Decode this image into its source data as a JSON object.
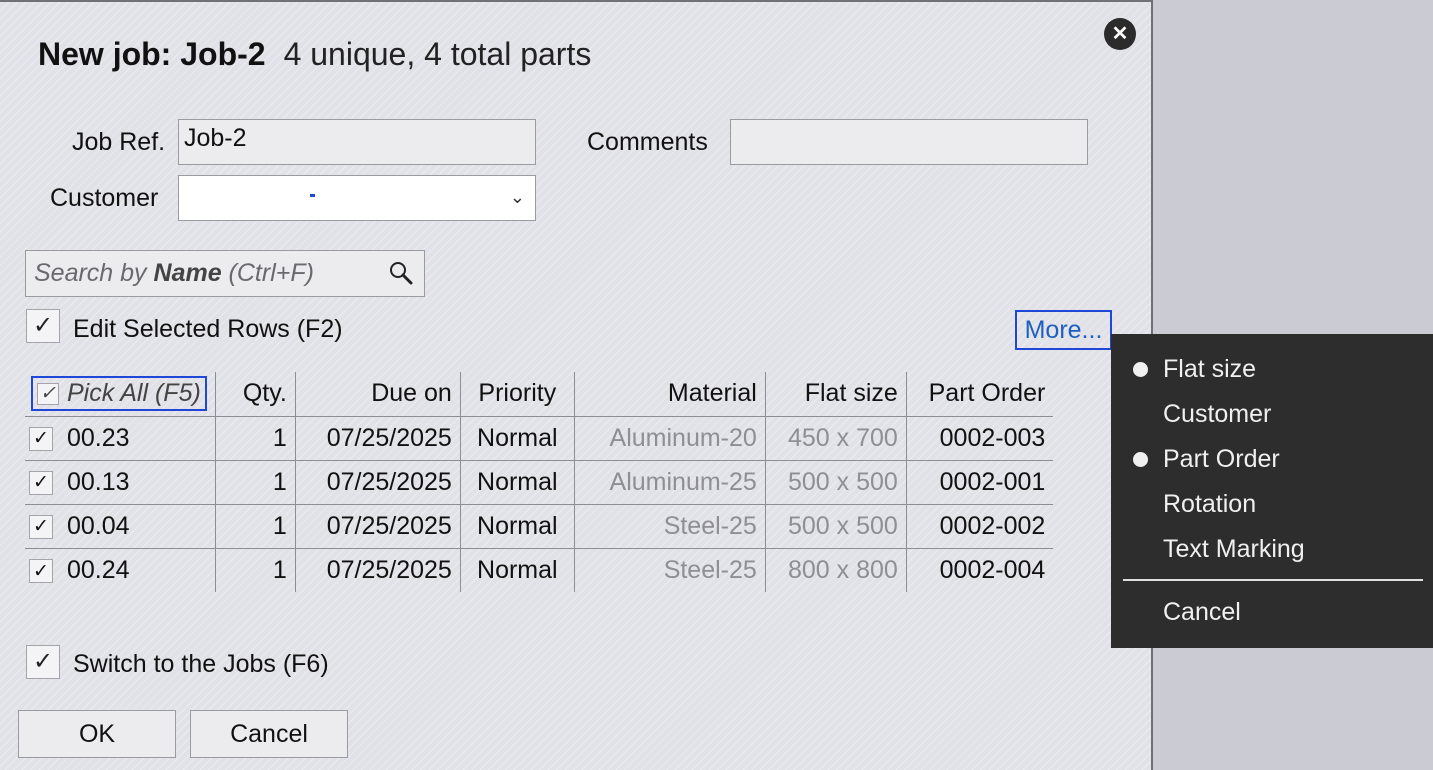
{
  "dialog": {
    "title": "New job: Job-2",
    "subtitle": "4 unique, 4 total parts",
    "close_label": "✕"
  },
  "form": {
    "job_ref_label": "Job Ref.",
    "job_ref_value": "Job-2",
    "comments_label": "Comments",
    "comments_value": "",
    "customer_label": "Customer",
    "customer_value": ""
  },
  "search": {
    "prefix": "Search by ",
    "bold": "Name",
    "suffix": " (Ctrl+F)"
  },
  "edit_selected": {
    "label": "Edit Selected Rows (F2)",
    "checked": true
  },
  "more_label": "More...",
  "table": {
    "headers": {
      "pick_all": "Pick All (F5)",
      "qty": "Qty.",
      "due_on": "Due on",
      "priority": "Priority",
      "material": "Material",
      "flat_size": "Flat size",
      "part_order": "Part Order"
    },
    "rows": [
      {
        "name": "00.23",
        "qty": "1",
        "due_on": "07/25/2025",
        "priority": "Normal",
        "material": "Aluminum-20",
        "flat_size": "450 x 700",
        "part_order": "0002-003",
        "checked": true
      },
      {
        "name": "00.13",
        "qty": "1",
        "due_on": "07/25/2025",
        "priority": "Normal",
        "material": "Aluminum-25",
        "flat_size": "500 x 500",
        "part_order": "0002-001",
        "checked": true
      },
      {
        "name": "00.04",
        "qty": "1",
        "due_on": "07/25/2025",
        "priority": "Normal",
        "material": "Steel-25",
        "flat_size": "500 x 500",
        "part_order": "0002-002",
        "checked": true
      },
      {
        "name": "00.24",
        "qty": "1",
        "due_on": "07/25/2025",
        "priority": "Normal",
        "material": "Steel-25",
        "flat_size": "800 x 800",
        "part_order": "0002-004",
        "checked": true
      }
    ]
  },
  "switch_jobs": {
    "label": "Switch to the Jobs (F6)",
    "checked": true
  },
  "buttons": {
    "ok": "OK",
    "cancel": "Cancel"
  },
  "context_menu": {
    "items": [
      {
        "label": "Flat size",
        "selected": true
      },
      {
        "label": "Customer",
        "selected": false
      },
      {
        "label": "Part Order",
        "selected": true
      },
      {
        "label": "Rotation",
        "selected": false
      },
      {
        "label": "Text Marking",
        "selected": false
      }
    ],
    "cancel": "Cancel"
  },
  "check_glyph": "✓",
  "colors": {
    "accent_blue": "#1f47d8",
    "menu_bg": "#2d2d2d",
    "link_blue": "#1f5fbf"
  }
}
